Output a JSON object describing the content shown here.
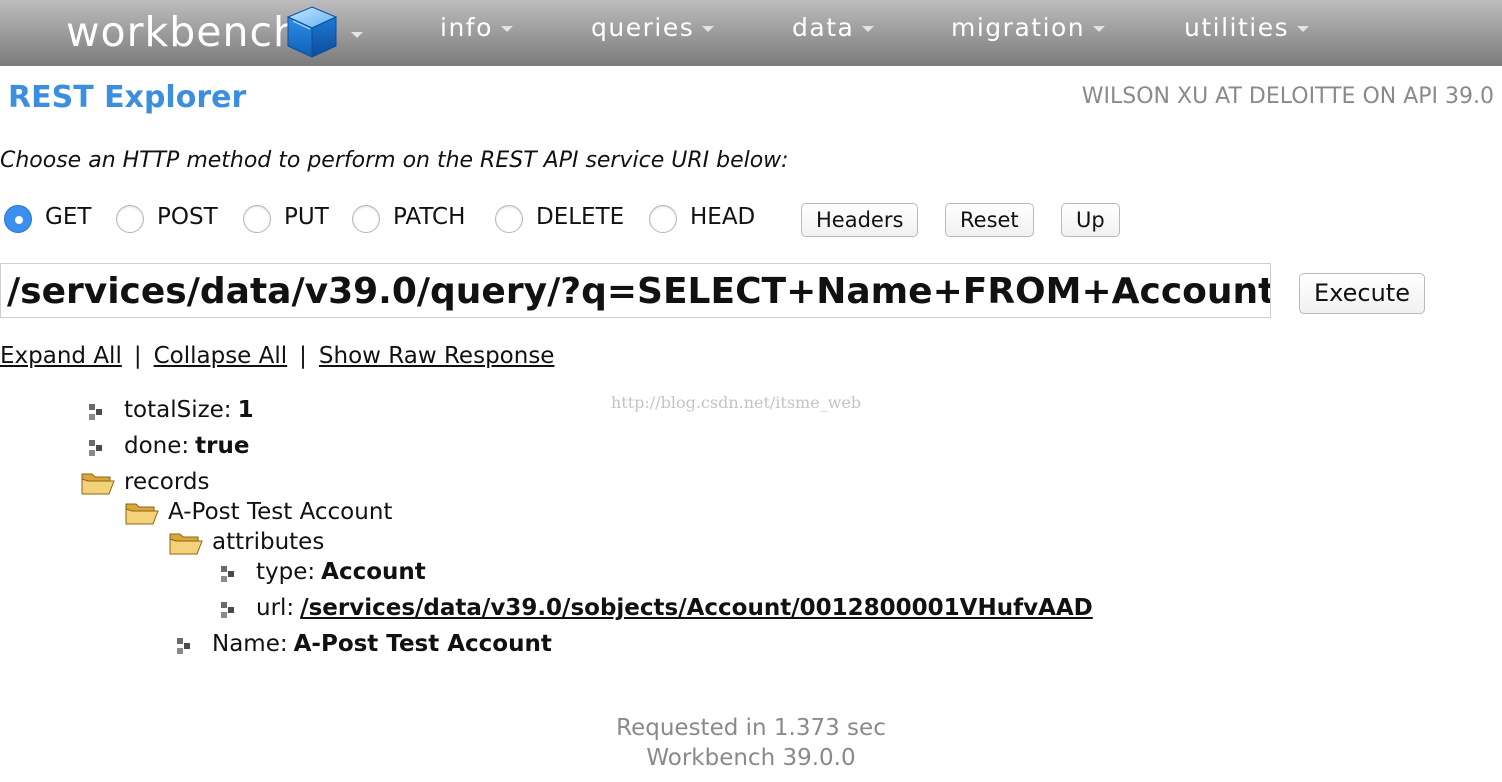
{
  "nav": {
    "brand": "workbench",
    "items": [
      {
        "label": "info"
      },
      {
        "label": "queries"
      },
      {
        "label": "data"
      },
      {
        "label": "migration"
      },
      {
        "label": "utilities"
      }
    ]
  },
  "header": {
    "title": "REST Explorer",
    "user_info": "WILSON XU AT DELOITTE ON API 39.0"
  },
  "instruction": "Choose an HTTP method to perform on the REST API service URI below:",
  "methods": {
    "selected": "GET",
    "options": [
      "GET",
      "POST",
      "PUT",
      "PATCH",
      "DELETE",
      "HEAD"
    ]
  },
  "buttons": {
    "headers": "Headers",
    "reset": "Reset",
    "up": "Up",
    "execute": "Execute"
  },
  "uri": "/services/data/v39.0/query/?q=SELECT+Name+FROM+Account",
  "links": {
    "expand_all": "Expand All",
    "collapse_all": "Collapse All",
    "show_raw": "Show Raw Response",
    "separator": "|"
  },
  "watermark": "http://blog.csdn.net/itsme_web",
  "tree": {
    "totalSize": {
      "key": "totalSize:",
      "value": "1"
    },
    "done": {
      "key": "done:",
      "value": "true"
    },
    "records": {
      "label": "records"
    },
    "record_name": "A-Post Test Account",
    "attributes": {
      "label": "attributes"
    },
    "type": {
      "key": "type:",
      "value": "Account"
    },
    "url": {
      "key": "url:",
      "value": "/services/data/v39.0/sobjects/Account/0012800001VHufvAAD"
    },
    "name": {
      "key": "Name:",
      "value": "A-Post Test Account"
    }
  },
  "footer": {
    "request_time": "Requested in 1.373 sec",
    "version": "Workbench 39.0.0"
  }
}
